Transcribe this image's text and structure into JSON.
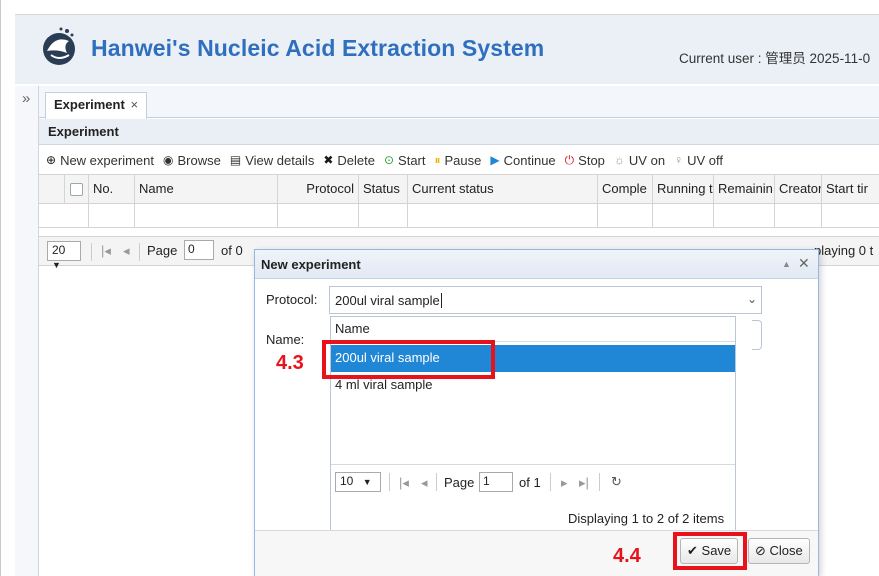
{
  "header": {
    "app_title": "Hanwei's Nucleic Acid Extraction System",
    "user_info": "Current user : 管理员  2025-11-0"
  },
  "nav": {
    "collapse_glyph": "»"
  },
  "tabs": [
    {
      "label": "Experiment",
      "close": "×"
    }
  ],
  "panel": {
    "title": "Experiment"
  },
  "toolbar": {
    "items": [
      {
        "label": "New experiment",
        "icon": "plus-circle-icon",
        "color": "#1a1a1a"
      },
      {
        "label": "Browse",
        "icon": "eye-icon",
        "color": "#333333"
      },
      {
        "label": "View details",
        "icon": "document-icon",
        "color": "#333333"
      },
      {
        "label": "Delete",
        "icon": "x-icon",
        "color": "#1a1a1a"
      },
      {
        "label": "Start",
        "icon": "play-circle-icon",
        "color": "#2e9e3a"
      },
      {
        "label": "Pause",
        "icon": "pause-circle-icon",
        "color": "#f0b400"
      },
      {
        "label": "Continue",
        "icon": "continue-circle-icon",
        "color": "#1f87d6"
      },
      {
        "label": "Stop",
        "icon": "power-icon",
        "color": "#d81e1e"
      },
      {
        "label": "UV on",
        "icon": "bulb-on-icon",
        "color": "#999999"
      },
      {
        "label": "UV off",
        "icon": "bulb-off-icon",
        "color": "#999999"
      }
    ]
  },
  "grid": {
    "columns": [
      "No.",
      "Name",
      "Protocol",
      "Status",
      "Current status",
      "Comple",
      "Running t",
      "Remainin",
      "Creator",
      "Start tir"
    ]
  },
  "pager": {
    "page_size": "20",
    "page_label": "Page",
    "page_value": "0",
    "of_label": "of 0",
    "display_text": "playing 0 t"
  },
  "dialog": {
    "title": "New experiment",
    "protocol_label": "Protocol:",
    "protocol_value": "200ul viral sample",
    "name_label": "Name:",
    "dropdown": {
      "header": "Name",
      "options": [
        "200ul viral sample",
        "4 ml viral sample"
      ],
      "selected_index": 0,
      "page_size": "10",
      "page_label": "Page",
      "page_value": "1",
      "of_label": "of 1",
      "display_text": "Displaying 1 to 2 of 2 items"
    },
    "save_label": "Save",
    "close_label": "Close"
  },
  "annotations": {
    "step_select": "4.3",
    "step_save": "4.4",
    "highlight_color": "#e8121b"
  }
}
